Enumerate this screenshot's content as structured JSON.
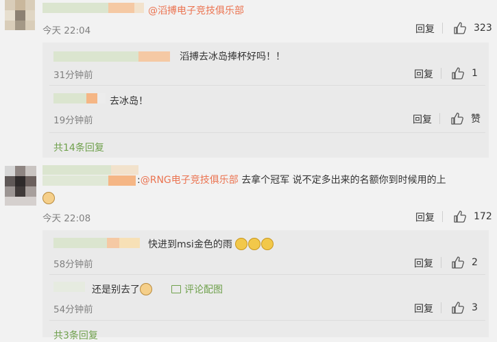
{
  "comments": [
    {
      "mention": "@滔搏电子竞技俱乐部",
      "time": "今天 22:04",
      "reply_label": "回复",
      "likes": "323",
      "replies": [
        {
          "text": "滔搏去冰岛捧杯好吗！！",
          "time": "31分钟前",
          "reply_label": "回复",
          "likes": "1"
        },
        {
          "text": "去冰岛！",
          "time": "19分钟前",
          "reply_label": "回复",
          "likes": "赞"
        }
      ],
      "more_replies": "共14条回复"
    },
    {
      "prefix": ":",
      "mention": "@RNG电子竞技俱乐部",
      "text": " 去拿个冠军 说不定多出来的名额你到时候用的上",
      "time": "今天 22:08",
      "reply_label": "回复",
      "likes": "172",
      "replies": [
        {
          "text": "快进到msi金色的雨",
          "time": "58分钟前",
          "reply_label": "回复",
          "likes": "2"
        },
        {
          "text": "还是别去了",
          "link": "评论配图",
          "time": "54分钟前",
          "reply_label": "回复",
          "likes": "3"
        }
      ],
      "more_replies": "共3条回复"
    }
  ],
  "icons": {
    "thumb": "thumbs-up-icon",
    "image": "image-icon",
    "emoji_cry": "crying-emoji-icon",
    "emoji_dog": "doge-emoji-icon"
  },
  "colors": {
    "link": "#eb7350",
    "more": "#6ea04b",
    "muted": "#808080"
  }
}
